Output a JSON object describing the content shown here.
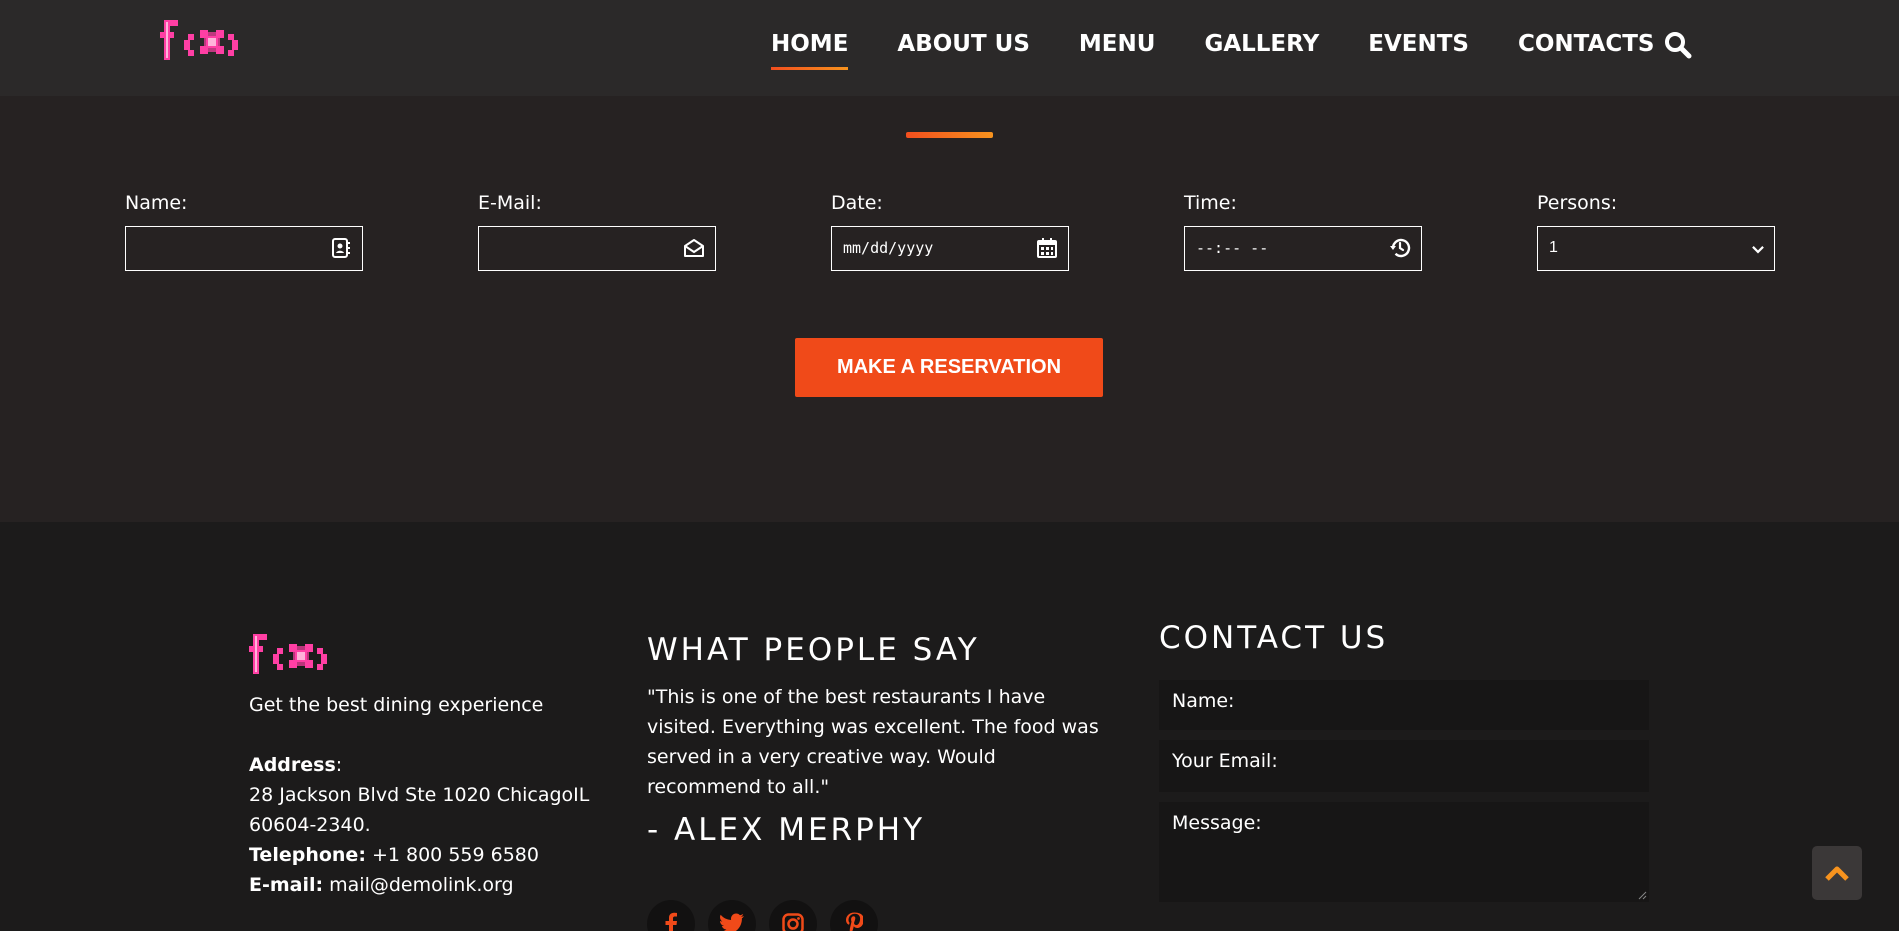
{
  "header": {
    "nav": [
      {
        "label": "HOME",
        "active": true
      },
      {
        "label": "ABOUT US"
      },
      {
        "label": "MENU"
      },
      {
        "label": "GALLERY"
      },
      {
        "label": "EVENTS"
      },
      {
        "label": "CONTACTS"
      }
    ],
    "search_icon": "search-icon"
  },
  "reservation": {
    "fields": {
      "name_label": "Name:",
      "email_label": "E-Mail:",
      "date_label": "Date:",
      "date_placeholder": "mm/dd/yyyy",
      "time_label": "Time:",
      "time_placeholder": "--:-- --",
      "persons_label": "Persons:",
      "persons_value": "1"
    },
    "button_label": "MAKE A RESERVATION"
  },
  "footer": {
    "tagline": "Get the best dining experience",
    "address_label": "Address",
    "address_colon": ":",
    "address_line1": "28 Jackson Blvd Ste 1020 ChicagoIL",
    "address_line2": "60604-2340.",
    "telephone_label": "Telephone:",
    "telephone_value": " +1 800 559 6580",
    "email_label": "E-mail:",
    "email_value": " mail@demolink.org",
    "testimonials_heading": "WHAT PEOPLE SAY",
    "quote": "\"This is one of the best restaurants I have visited. Everything was excellent. The food was served in a very creative way. Would recommend to all.\"",
    "author": "- ALEX MERPHY",
    "socials": [
      "facebook-icon",
      "twitter-icon",
      "instagram-icon",
      "pinterest-icon"
    ],
    "contact_heading": "CONTACT US",
    "contact_form": {
      "name_placeholder": "Name:",
      "email_placeholder": "Your Email:",
      "message_placeholder": "Message:"
    }
  },
  "colors": {
    "accent": "#f04a19",
    "accent_gradient_end": "#f7931e",
    "logo_pink": "#ff3fa4",
    "header_bg": "#2b2929",
    "section_bg": "#262222",
    "footer_bg": "#1c1b1b"
  }
}
